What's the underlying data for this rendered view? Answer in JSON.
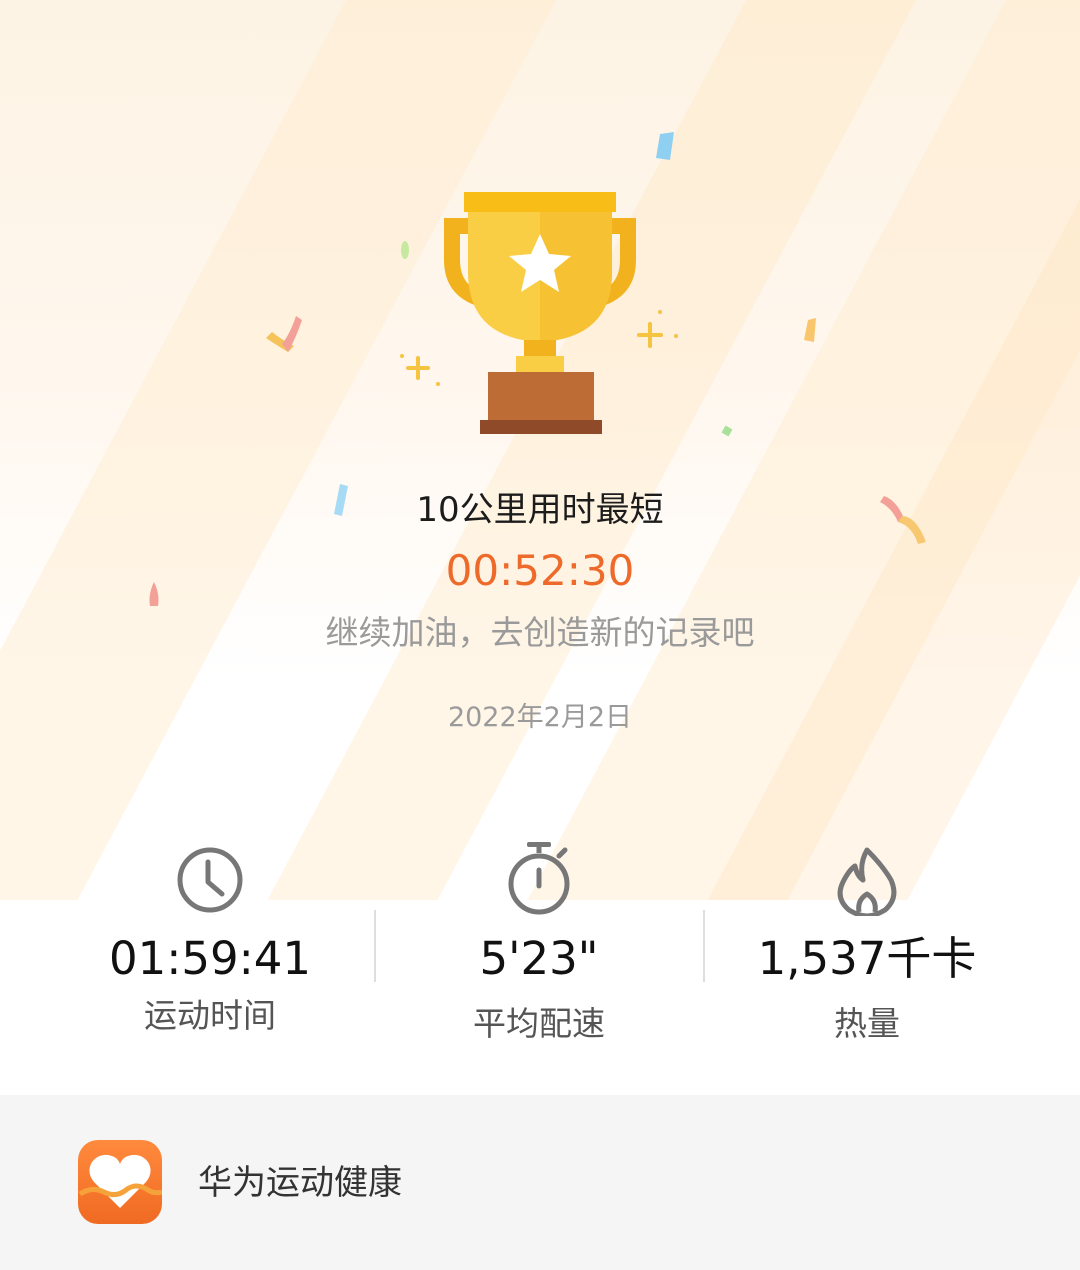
{
  "record": {
    "title": "10公里用时最短",
    "value": "00:52:30",
    "encouragement": "继续加油，去创造新的记录吧",
    "date": "2022年2月2日"
  },
  "stats": [
    {
      "icon": "clock-icon",
      "value": "01:59:41",
      "label": "运动时间"
    },
    {
      "icon": "stopwatch-icon",
      "value": "5'23\"",
      "label": "平均配速"
    },
    {
      "icon": "flame-icon",
      "value": "1,537千卡",
      "label": "热量"
    }
  ],
  "footer": {
    "app_icon": "heart-health-app-icon",
    "app_name": "华为运动健康"
  },
  "colors": {
    "accent": "#ee6a2b",
    "trophy_gold": "#f7c33a",
    "trophy_base": "#b86a36",
    "footer_bg": "#f5f5f5",
    "app_icon_bg": "#f27325"
  }
}
